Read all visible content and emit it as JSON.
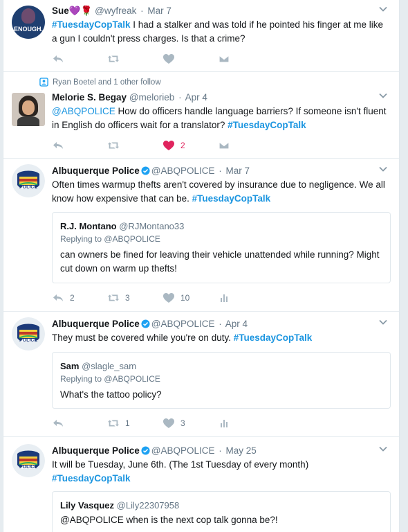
{
  "tweets": [
    {
      "fullname": "Sue",
      "name_emojis": "💜🌹",
      "handle": "@wyfreak",
      "date": "Mar 7",
      "avatar_text": "ENOUGH.",
      "text_parts": [
        {
          "kind": "hashtag",
          "value": "#TuesdayCopTalk"
        },
        {
          "kind": "plain",
          "value": " I had a stalker and was told if he pointed his finger at me like a gun I couldn't press charges. Is that a crime?"
        }
      ],
      "actions": {
        "reply": "",
        "retweet": "",
        "like": ""
      }
    },
    {
      "context": "Ryan Boetel and 1 other follow",
      "fullname": "Melorie S. Begay",
      "handle": "@melorieb",
      "date": "Apr 4",
      "text_parts": [
        {
          "kind": "mention",
          "value": "@ABQPOLICE"
        },
        {
          "kind": "plain",
          "value": " How do officers handle language barriers? If someone isn't fluent in English do officers wait for a translator?  "
        },
        {
          "kind": "hashtag",
          "value": "#TuesdayCopTalk"
        }
      ],
      "actions": {
        "reply": "",
        "retweet": "",
        "like": "2"
      }
    },
    {
      "fullname": "Albuquerque Police",
      "handle": "@ABQPOLICE",
      "date": "Mar 7",
      "avatar_label": "POLICE",
      "text_parts": [
        {
          "kind": "plain",
          "value": "Often times warmup thefts aren't covered by insurance due to negligence. We all know how expensive that can be. "
        },
        {
          "kind": "hashtag",
          "value": "#TuesdayCopTalk"
        }
      ],
      "quote": {
        "name": "R.J. Montano",
        "handle": "@RJMontano33",
        "replying": "Replying to @ABQPOLICE",
        "text": "can owners be fined for leaving their vehicle unattended while running? Might cut down on warm up thefts!"
      },
      "actions": {
        "reply": "2",
        "retweet": "3",
        "like": "10"
      }
    },
    {
      "fullname": "Albuquerque Police",
      "handle": "@ABQPOLICE",
      "date": "Apr 4",
      "avatar_label": "POLICE",
      "text_parts": [
        {
          "kind": "plain",
          "value": "They must be covered while you're on duty. "
        },
        {
          "kind": "hashtag",
          "value": "#TuesdayCopTalk"
        }
      ],
      "quote": {
        "name": "Sam",
        "handle": "@slagle_sam",
        "replying": "Replying to @ABQPOLICE",
        "text": "What's the tattoo policy?"
      },
      "actions": {
        "reply": "",
        "retweet": "1",
        "like": "3"
      }
    },
    {
      "fullname": "Albuquerque Police",
      "handle": "@ABQPOLICE",
      "date": "May 25",
      "avatar_label": "POLICE",
      "text_parts": [
        {
          "kind": "plain",
          "value": "It will be Tuesday, June 6th. (The 1st Tuesday of every month) "
        },
        {
          "kind": "hashtag",
          "value": "#TuesdayCopTalk"
        }
      ],
      "quote": {
        "name": "Lily Vasquez",
        "handle": "@Lily22307958",
        "replying": "",
        "text": "@ABQPOLICE when is the next cop talk gonna be?!"
      }
    }
  ],
  "colors": {
    "link": "#1b95e0",
    "like": "#e0245e",
    "muted": "#657786",
    "icon": "#aab8c2",
    "verified": "#1da1f2"
  },
  "icons": [
    "reply-icon",
    "retweet-icon",
    "heart-icon",
    "dm-icon",
    "analytics-icon",
    "verified-badge-icon",
    "caret-down-icon",
    "follow-context-icon"
  ]
}
